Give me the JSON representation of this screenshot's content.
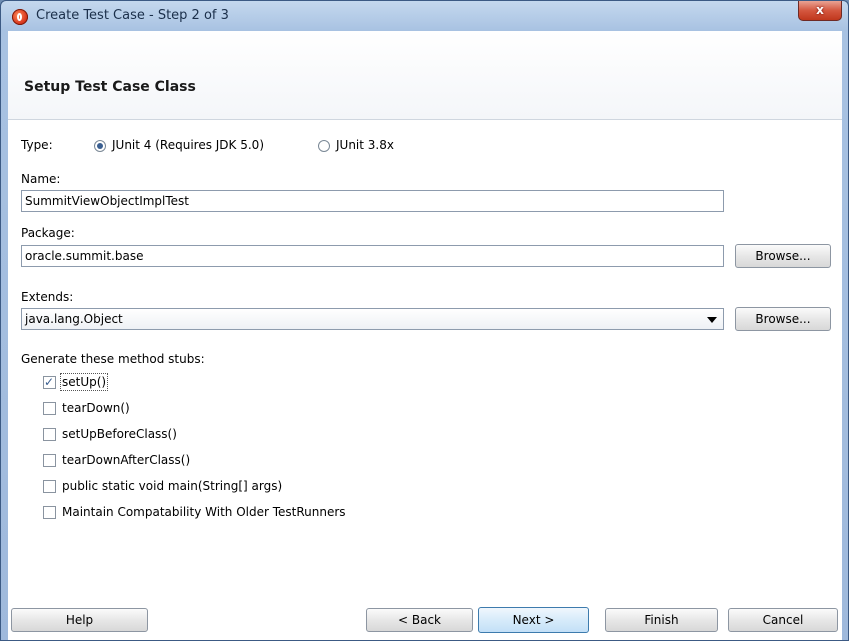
{
  "window": {
    "title": "Create Test Case - Step 2 of 3",
    "close_label": "x"
  },
  "header": {
    "title": "Setup Test Case Class"
  },
  "type": {
    "label": "Type:",
    "options": [
      {
        "label": "JUnit 4 (Requires JDK 5.0)",
        "selected": true
      },
      {
        "label": "JUnit 3.8x",
        "selected": false
      }
    ]
  },
  "name": {
    "label": "Name:",
    "value": "SummitViewObjectImplTest"
  },
  "package": {
    "label": "Package:",
    "value": "oracle.summit.base",
    "browse_label": "Browse..."
  },
  "extends": {
    "label": "Extends:",
    "value": "java.lang.Object",
    "browse_label": "Browse..."
  },
  "stubs": {
    "label": "Generate these method stubs:",
    "items": [
      {
        "label": "setUp()",
        "checked": true
      },
      {
        "label": "tearDown()",
        "checked": false
      },
      {
        "label": "setUpBeforeClass()",
        "checked": false
      },
      {
        "label": "tearDownAfterClass()",
        "checked": false
      },
      {
        "label": "public static void main(String[] args)",
        "checked": false
      },
      {
        "label": "Maintain Compatability With Older TestRunners",
        "checked": false
      }
    ]
  },
  "footer": {
    "help": "Help",
    "back": "< Back",
    "next": "Next >",
    "finish": "Finish",
    "cancel": "Cancel"
  }
}
